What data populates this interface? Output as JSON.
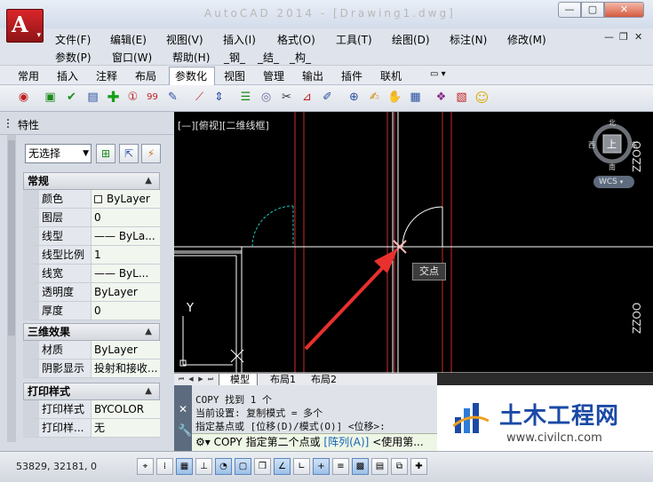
{
  "window": {
    "title": "AutoCAD 2014 - [Drawing1.dwg]",
    "app_button_letter": "A",
    "controls": {
      "minimize": "—",
      "maximize": "▢",
      "close": "✕"
    }
  },
  "menubar": {
    "row1": [
      "文件(F)",
      "编辑(E)",
      "视图(V)",
      "插入(I)",
      "格式(O)",
      "工具(T)",
      "绘图(D)",
      "标注(N)",
      "修改(M)"
    ],
    "row2": [
      "参数(P)",
      "窗口(W)",
      "帮助(H)",
      "_钢_",
      "_结_",
      "_构_"
    ],
    "mdi": {
      "min": "—",
      "restore": "❐",
      "close": "✕"
    }
  },
  "ribbon": {
    "tabs": [
      "常用",
      "插入",
      "注释",
      "布局",
      "参数化",
      "视图",
      "管理",
      "输出",
      "插件",
      "联机"
    ],
    "active_tab": "参数化",
    "extra": "▭ ▾"
  },
  "properties": {
    "title": "特性",
    "selection": "无选择",
    "sections": [
      {
        "name": "常规",
        "rows": [
          {
            "label": "颜色",
            "value": "ByLayer"
          },
          {
            "label": "图层",
            "value": "0"
          },
          {
            "label": "线型",
            "value": "—— ByLa..."
          },
          {
            "label": "线型比例",
            "value": "1"
          },
          {
            "label": "线宽",
            "value": "—— ByL..."
          },
          {
            "label": "透明度",
            "value": "ByLayer"
          },
          {
            "label": "厚度",
            "value": "0"
          }
        ]
      },
      {
        "name": "三维效果",
        "rows": [
          {
            "label": "材质",
            "value": "ByLayer"
          },
          {
            "label": "阴影显示",
            "value": "投射和接收..."
          }
        ]
      },
      {
        "name": "打印样式",
        "rows": [
          {
            "label": "打印样式",
            "value": "BYCOLOR"
          },
          {
            "label": "打印样...",
            "value": "无"
          }
        ]
      }
    ]
  },
  "viewport": {
    "label": "[—][俯视][二维线框]",
    "tooltip": "交点",
    "viewcube": {
      "top": "上",
      "north": "北",
      "south": "南",
      "east": "东",
      "west": "西"
    },
    "wcs": "WCS",
    "side_labels": [
      "ZZOO",
      "ZZOO",
      "ZZOO"
    ],
    "ucs_y": "Y"
  },
  "layout_tabs": [
    "模型",
    "布局1",
    "布局2"
  ],
  "command": {
    "history": [
      "COPY 找到 1 个",
      "当前设置:  复制模式 = 多个",
      "指定基点或 [位移(D)/模式(O)] <位移>:"
    ],
    "prompt_cmd": "COPY",
    "prompt_text": "指定第二个点或",
    "prompt_opt": "[阵列(A)]",
    "prompt_tail": "<使用第..."
  },
  "watermark": {
    "title": "土木工程网",
    "url": "www.civilcn.com"
  },
  "status": {
    "coords": "53829, 32181, 0"
  },
  "colors": {
    "accent_red": "#d9262a",
    "arrow": "#e8302e",
    "grid_red": "#cc2a2a",
    "snap_cross": "#ffb8b8"
  },
  "icons": {
    "toolbar": [
      "layer-icon",
      "rectangle-icon",
      "check-icon",
      "block-icon",
      "plus-icon",
      "info-icon",
      "number-icon",
      "edit-icon",
      "pen-icon",
      "distance-icon",
      "list-icon",
      "eye-icon",
      "scissors-icon",
      "measure-icon",
      "attribute-icon",
      "zoom-icon",
      "paint-icon",
      "pan-icon",
      "calculator-icon",
      "render-icon",
      "sheet-icon",
      "smile-icon"
    ]
  }
}
